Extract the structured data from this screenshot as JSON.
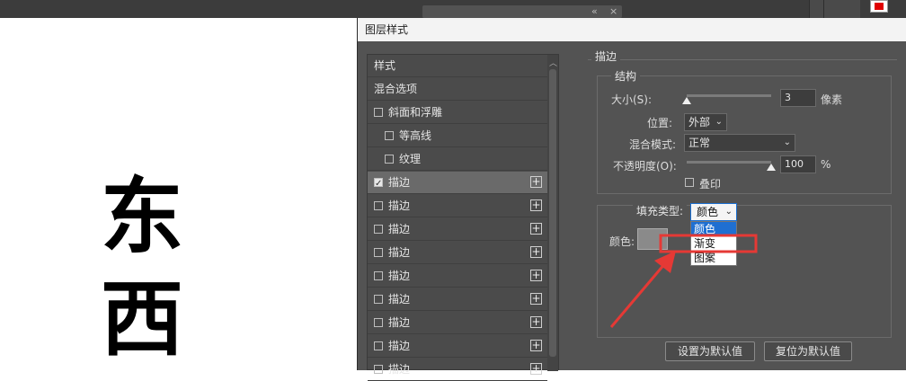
{
  "topbar": {
    "collapse_glyph": "«",
    "close_glyph": "×"
  },
  "canvas": {
    "char1": "东",
    "char2": "西"
  },
  "dialog": {
    "title": "图层样式",
    "styles_list": [
      {
        "label": "样式",
        "has_checkbox": false,
        "checked": false,
        "indent": false,
        "has_plus": false,
        "selected": false
      },
      {
        "label": "混合选项",
        "has_checkbox": false,
        "checked": false,
        "indent": false,
        "has_plus": false,
        "selected": false
      },
      {
        "label": "斜面和浮雕",
        "has_checkbox": true,
        "checked": false,
        "indent": false,
        "has_plus": false,
        "selected": false
      },
      {
        "label": "等高线",
        "has_checkbox": true,
        "checked": false,
        "indent": true,
        "has_plus": false,
        "selected": false
      },
      {
        "label": "纹理",
        "has_checkbox": true,
        "checked": false,
        "indent": true,
        "has_plus": false,
        "selected": false
      },
      {
        "label": "描边",
        "has_checkbox": true,
        "checked": true,
        "indent": false,
        "has_plus": true,
        "selected": true
      },
      {
        "label": "描边",
        "has_checkbox": true,
        "checked": false,
        "indent": false,
        "has_plus": true,
        "selected": false
      },
      {
        "label": "描边",
        "has_checkbox": true,
        "checked": false,
        "indent": false,
        "has_plus": true,
        "selected": false
      },
      {
        "label": "描边",
        "has_checkbox": true,
        "checked": false,
        "indent": false,
        "has_plus": true,
        "selected": false
      },
      {
        "label": "描边",
        "has_checkbox": true,
        "checked": false,
        "indent": false,
        "has_plus": true,
        "selected": false
      },
      {
        "label": "描边",
        "has_checkbox": true,
        "checked": false,
        "indent": false,
        "has_plus": true,
        "selected": false
      },
      {
        "label": "描边",
        "has_checkbox": true,
        "checked": false,
        "indent": false,
        "has_plus": true,
        "selected": false
      },
      {
        "label": "描边",
        "has_checkbox": true,
        "checked": false,
        "indent": false,
        "has_plus": true,
        "selected": false
      },
      {
        "label": "描边",
        "has_checkbox": true,
        "checked": false,
        "indent": false,
        "has_plus": true,
        "selected": false
      }
    ],
    "plus_glyph": "+",
    "stroke": {
      "section_title": "描边",
      "structure_title": "结构",
      "size_label": "大小(S):",
      "size_value": "3",
      "size_unit": "像素",
      "size_slider_fraction": 0.0,
      "position_label": "位置:",
      "position_value": "外部",
      "blend_label": "混合模式:",
      "blend_value": "正常",
      "opacity_label": "不透明度(O):",
      "opacity_value": "100",
      "opacity_unit": "%",
      "opacity_slider_fraction": 1.0,
      "overprint_label": "叠印",
      "fill_type_label": "填充类型:",
      "fill_type_value": "颜色",
      "fill_type_options": [
        "颜色",
        "渐变",
        "图案"
      ],
      "highlighted_option": "颜色",
      "color_label": "颜色:",
      "color_swatch": "#8a8a8a"
    },
    "buttons": {
      "set_default": "设置为默认值",
      "reset_default": "复位为默认值"
    }
  },
  "colors": {
    "annotation_red": "#e53935",
    "highlight_blue": "#1f6fd1",
    "foreground_swatch": "#e00000"
  }
}
